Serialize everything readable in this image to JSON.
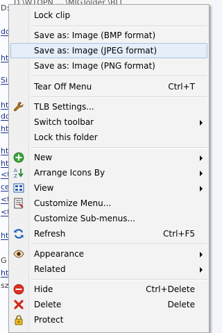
{
  "background": {
    "top_text": "D  \\WTOPN  ...  \\MIGTolder  \\BLL",
    "rows": [
      "D:",
      "do",
      "ht",
      "Si",
      "ht",
      "do",
      "ht",
      "ht",
      "ht",
      "<t",
      "ce",
      "<t",
      "<t",
      "ht",
      "G",
      "ht",
      "sz",
      ""
    ]
  },
  "menu": {
    "lock_clip": "Lock clip",
    "save_bmp": "Save as: Image (BMP format)",
    "save_jpeg": "Save as: Image (JPEG format)",
    "save_png": "Save as: Image (PNG format)",
    "tear_off": "Tear Off Menu",
    "tear_off_shortcut": "Ctrl+T",
    "tlb_settings": "TLB Settings...",
    "switch_toolbar": "Switch toolbar",
    "lock_folder": "Lock this folder",
    "new": "New",
    "arrange_icons": "Arrange Icons By",
    "view": "View",
    "customize_menu": "Customize Menu...",
    "customize_submenus": "Customize Sub-menus...",
    "refresh": "Refresh",
    "refresh_shortcut": "Ctrl+F5",
    "appearance": "Appearance",
    "related": "Related",
    "hide": "Hide",
    "hide_shortcut": "Ctrl+Delete",
    "delete": "Delete",
    "delete_shortcut": "Delete",
    "protect": "Protect"
  },
  "icons": {
    "tlb_settings": "wrench-icon",
    "new": "add-circle-icon",
    "arrange_icons": "sort-icon",
    "view": "view-grid-icon",
    "customize_menu": "customize-icon",
    "refresh": "refresh-icon",
    "appearance": "eye-icon",
    "hide": "stop-icon",
    "delete": "x-icon",
    "protect": "lock-icon"
  }
}
